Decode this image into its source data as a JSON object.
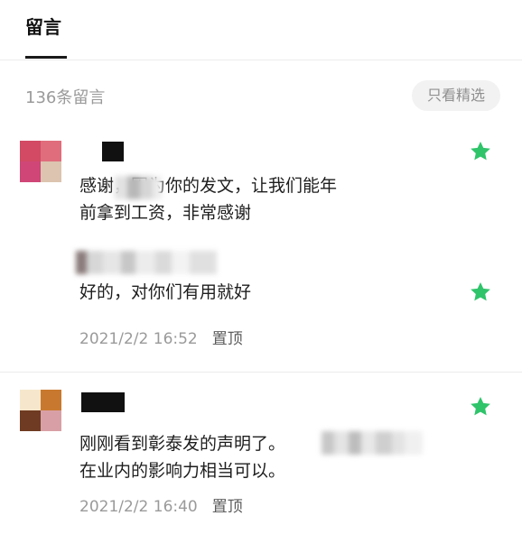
{
  "header": {
    "tab_label": "留言"
  },
  "toolbar": {
    "comment_count": "136条留言",
    "filter_label": "只看精选"
  },
  "comments": [
    {
      "text": "感谢，因为你的发文，让我们能年\n前拿到工资，非常感谢",
      "reply_text": "好的，对你们有用就好",
      "date": "2021/2/2 16:52",
      "pin_label": "置顶",
      "colors": {
        "avatar": [
          "#d14a63",
          "#e86d7e",
          "#d1447a",
          "#dcc4b0"
        ]
      }
    },
    {
      "text": "刚刚看到彰泰发的声明了。\n在业内的影响力相当可以。",
      "date": "2021/2/2 16:40",
      "pin_label": "置顶",
      "colors": {
        "avatar": [
          "#f6e7cc",
          "#c9792f",
          "#6f3b22",
          "#d8a0a6"
        ]
      }
    }
  ],
  "colors": {
    "star": "#2fc46a",
    "accent_text": "#1a1a1a"
  }
}
